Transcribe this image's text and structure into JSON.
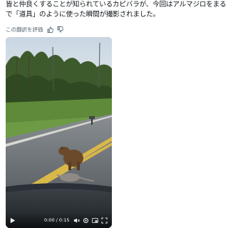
{
  "post": {
    "lines": [
      "皆と仲良くすることが知られているカピバラが、今回はアルマジロをまる",
      "で「道具」のように使った瞬間が撮影されました。"
    ]
  },
  "translate": {
    "label": "この翻訳を評価"
  },
  "video": {
    "time_display": "0:00 / 0:15",
    "progress": 0.0
  }
}
